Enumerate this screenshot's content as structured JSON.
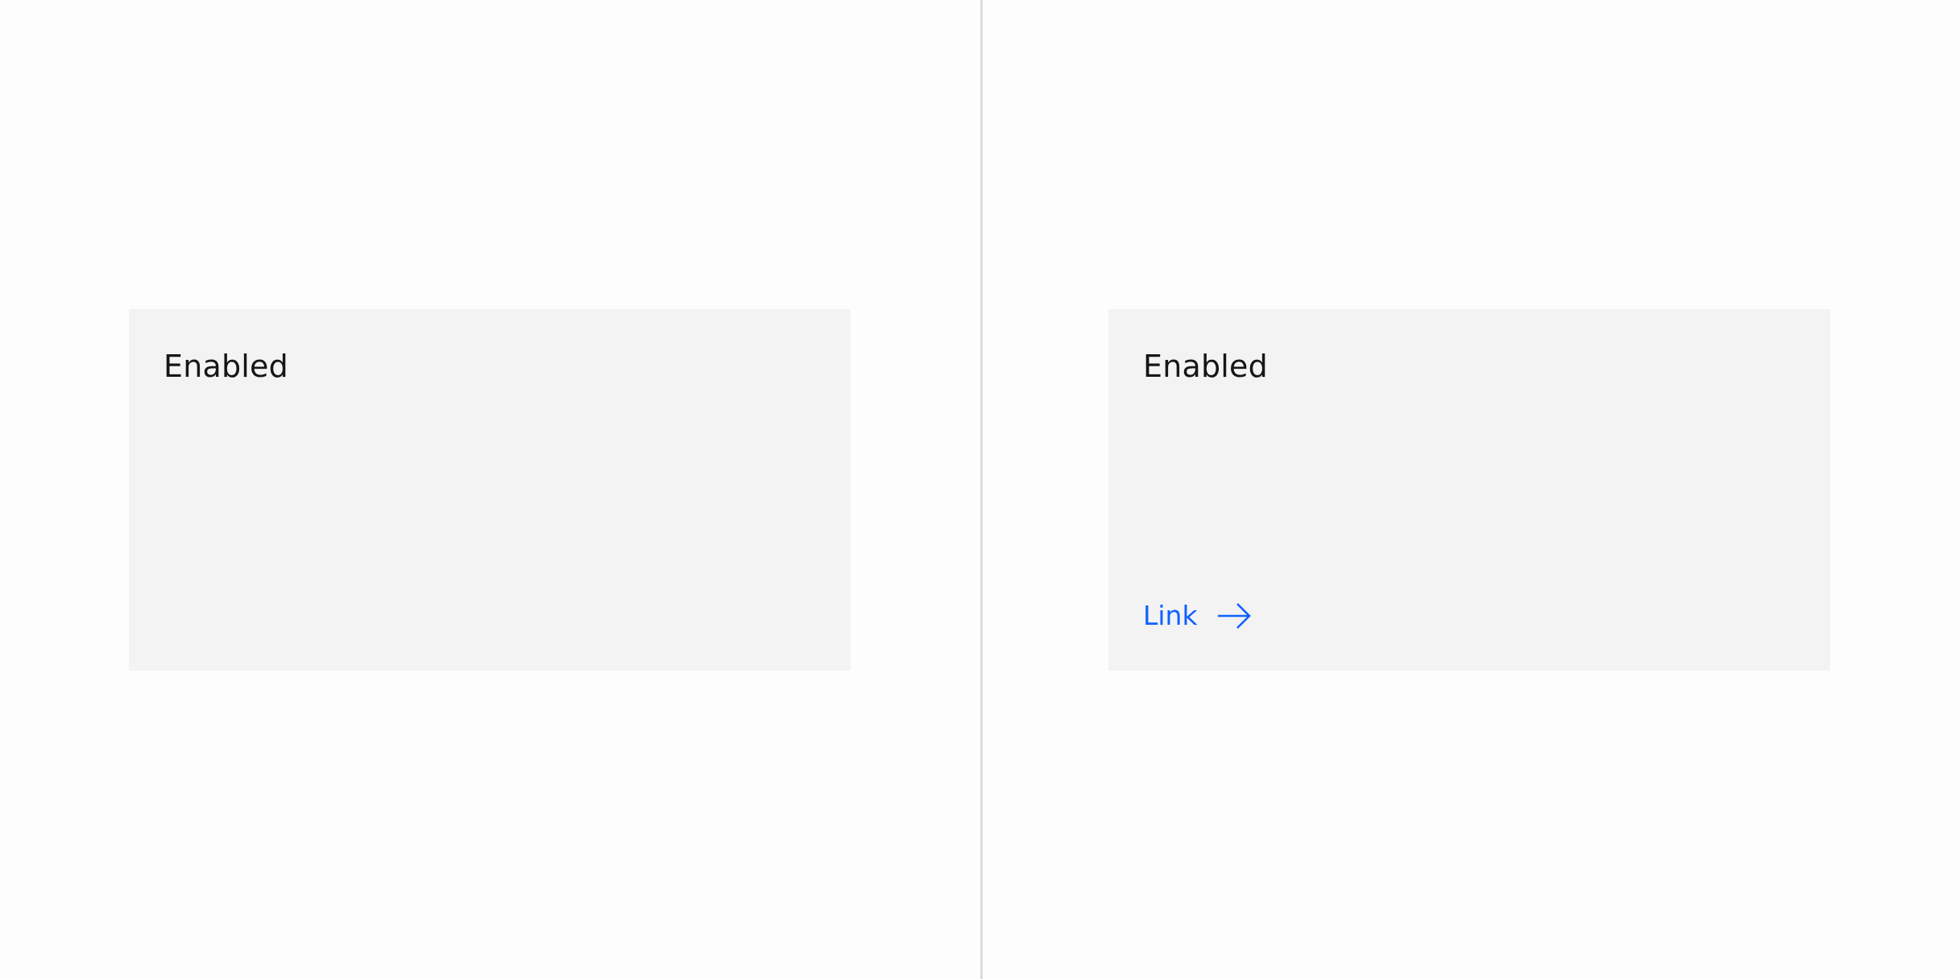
{
  "tiles": [
    {
      "title": "Enabled"
    },
    {
      "title": "Enabled",
      "link": {
        "label": "Link",
        "icon": "arrow-right-icon"
      }
    }
  ],
  "colors": {
    "page_background": "#fdfdfd",
    "tile_background": "#f3f3f3",
    "divider": "#dcdcdc",
    "text_primary": "#161616",
    "link": "#0f62fe"
  }
}
